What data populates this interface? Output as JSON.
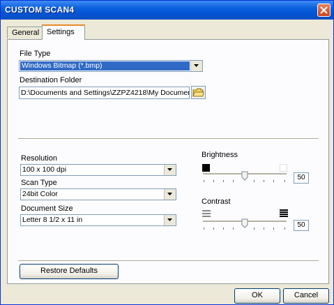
{
  "window": {
    "title": "CUSTOM SCAN4"
  },
  "tabs": [
    {
      "label": "General",
      "active": false
    },
    {
      "label": "Settings",
      "active": true
    }
  ],
  "file_type": {
    "label": "File Type",
    "value": "Windows Bitmap (*.bmp)"
  },
  "destination": {
    "label": "Destination Folder",
    "value": "D:\\Documents and Settings\\ZZPZ4218\\My Documen"
  },
  "resolution": {
    "label": "Resolution",
    "value": "100 x 100 dpi"
  },
  "scan_type": {
    "label": "Scan Type",
    "value": "24bit Color"
  },
  "document_size": {
    "label": "Document Size",
    "value": "Letter 8 1/2 x 11 in"
  },
  "brightness": {
    "label": "Brightness",
    "value": "50"
  },
  "contrast": {
    "label": "Contrast",
    "value": "50"
  },
  "buttons": {
    "restore": "Restore Defaults",
    "ok": "OK",
    "cancel": "Cancel"
  },
  "icons": {
    "close": "close-icon",
    "folder": "folder-icon",
    "dropdown": "chevron-down-icon"
  },
  "colors": {
    "titlebar": "#0553d3",
    "selection": "#316ac5",
    "dialog_bg": "#ece9d8",
    "tab_highlight": "#e68b2c"
  }
}
